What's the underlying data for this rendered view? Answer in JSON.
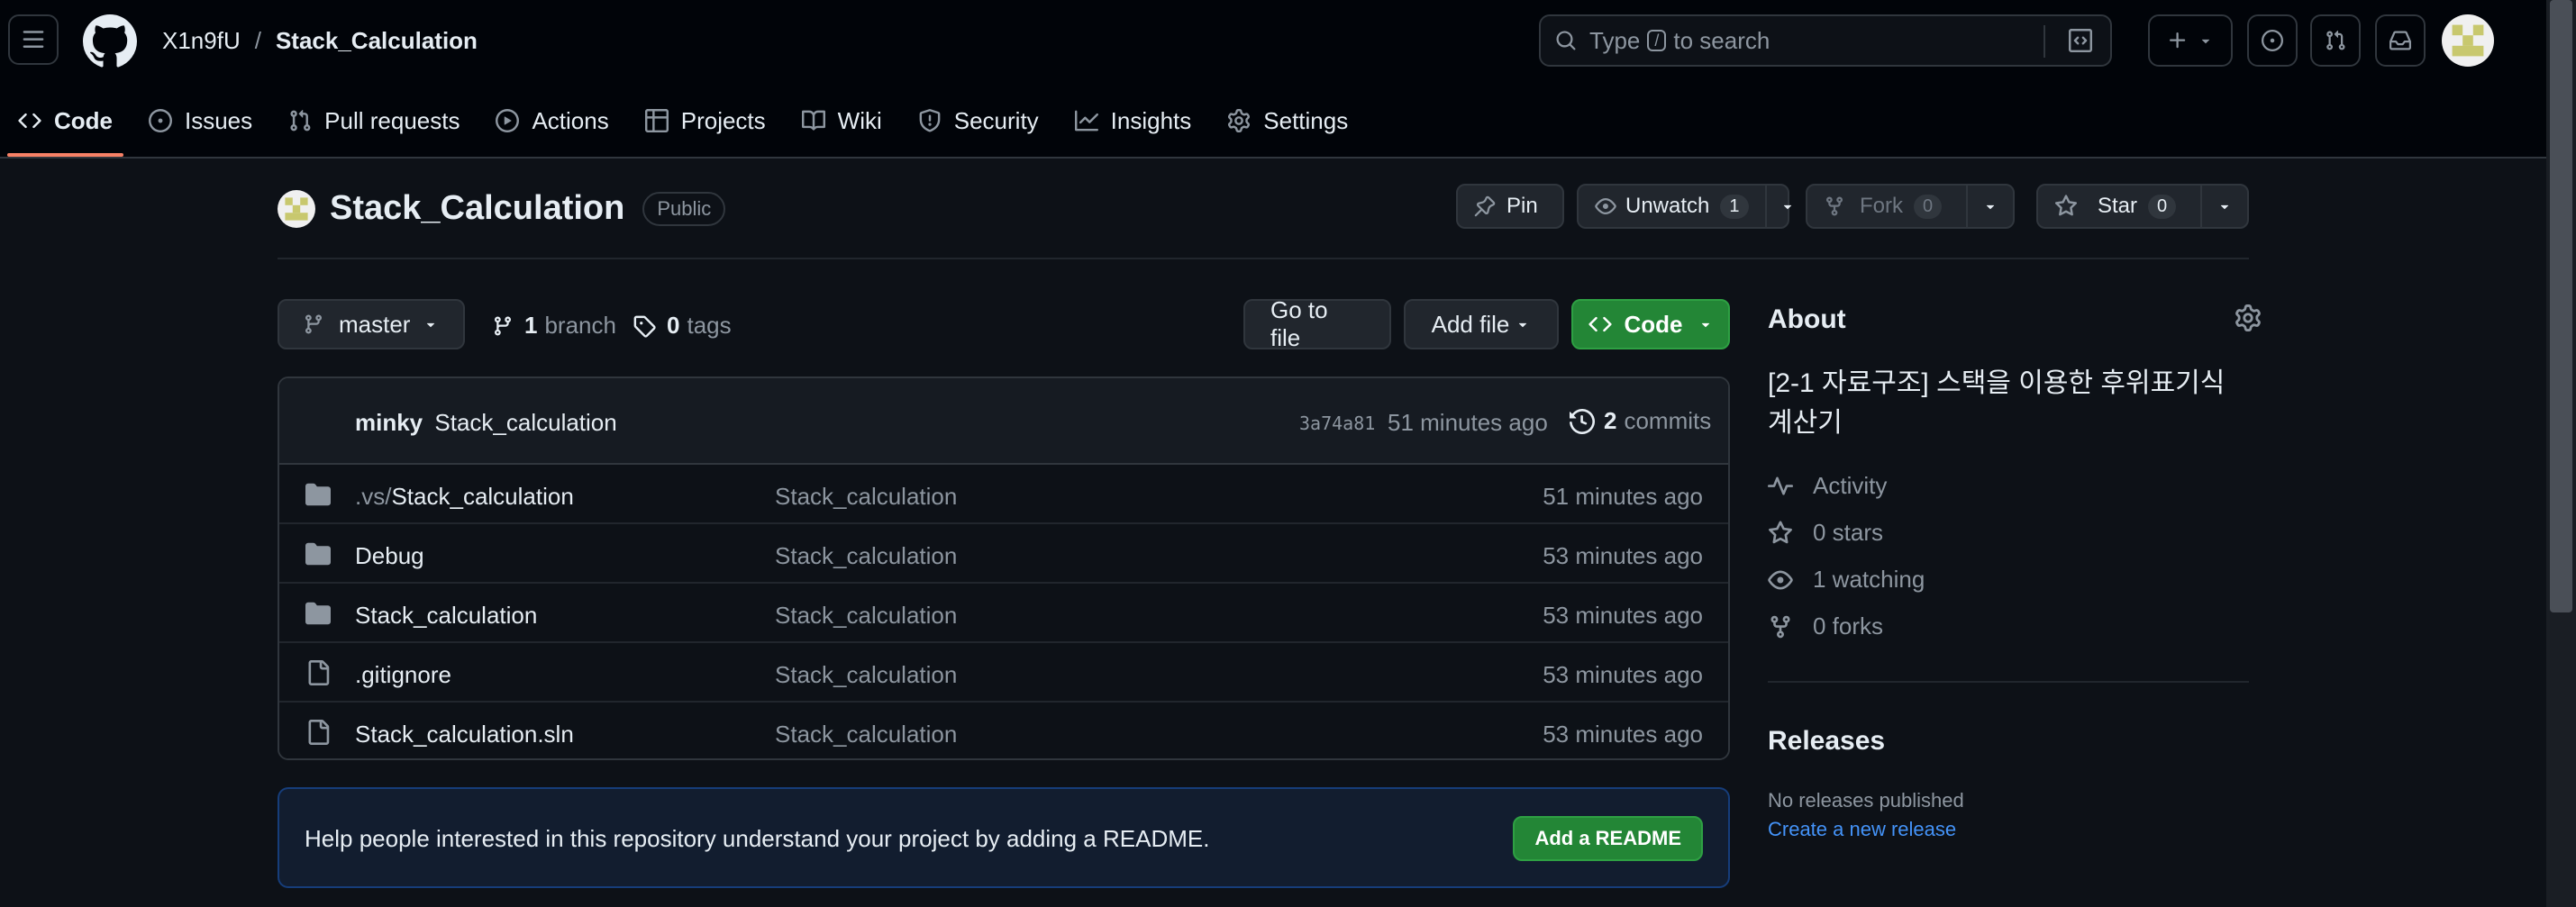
{
  "header": {
    "owner": "X1n9fU",
    "separator": "/",
    "repo": "Stack_Calculation",
    "search": {
      "prefix": "Type",
      "key": "/",
      "suffix": "to search"
    }
  },
  "tabs": [
    {
      "label": "Code",
      "icon": "code-icon",
      "active": true
    },
    {
      "label": "Issues",
      "icon": "issue-icon"
    },
    {
      "label": "Pull requests",
      "icon": "pull-request-icon"
    },
    {
      "label": "Actions",
      "icon": "play-icon"
    },
    {
      "label": "Projects",
      "icon": "table-icon"
    },
    {
      "label": "Wiki",
      "icon": "book-icon"
    },
    {
      "label": "Security",
      "icon": "shield-icon"
    },
    {
      "label": "Insights",
      "icon": "graph-icon"
    },
    {
      "label": "Settings",
      "icon": "gear-icon"
    }
  ],
  "repo": {
    "name": "Stack_Calculation",
    "visibility": "Public",
    "pin": "Pin",
    "unwatch": "Unwatch",
    "watch_count": "1",
    "fork": "Fork",
    "fork_count": "0",
    "star": "Star",
    "star_count": "0"
  },
  "branchbar": {
    "branch": "master",
    "branch_count": "1",
    "branch_label": "branch",
    "tag_count": "0",
    "tag_label": "tags",
    "go_to_file": "Go to file",
    "add_file": "Add file",
    "code": "Code"
  },
  "commit": {
    "author": "minky",
    "message": "Stack_calculation",
    "sha": "3a74a81",
    "time": "51 minutes ago",
    "commit_count": "2",
    "commit_label": "commits"
  },
  "files": [
    {
      "prefix": ".vs/",
      "name": "Stack_calculation",
      "type": "folder",
      "message": "Stack_calculation",
      "time": "51 minutes ago"
    },
    {
      "prefix": "",
      "name": "Debug",
      "type": "folder",
      "message": "Stack_calculation",
      "time": "53 minutes ago"
    },
    {
      "prefix": "",
      "name": "Stack_calculation",
      "type": "folder",
      "message": "Stack_calculation",
      "time": "53 minutes ago"
    },
    {
      "prefix": "",
      "name": ".gitignore",
      "type": "file",
      "message": "Stack_calculation",
      "time": "53 minutes ago"
    },
    {
      "prefix": "",
      "name": "Stack_calculation.sln",
      "type": "file",
      "message": "Stack_calculation",
      "time": "53 minutes ago"
    }
  ],
  "readme": {
    "text": "Help people interested in this repository understand your project by adding a README.",
    "button": "Add a README"
  },
  "about": {
    "title": "About",
    "description": "[2-1 자료구조] 스택을 이용한 후위표기식 계산기",
    "activity": "Activity",
    "stars": "0 stars",
    "watching": "1 watching",
    "forks": "0 forks"
  },
  "releases": {
    "title": "Releases",
    "none": "No releases published",
    "create": "Create a new release"
  },
  "colors": {
    "background": "#0d1117",
    "header": "#010409",
    "border": "#30363d",
    "primary_button": "#238636",
    "link": "#4493f8",
    "active_tab": "#f78166"
  }
}
